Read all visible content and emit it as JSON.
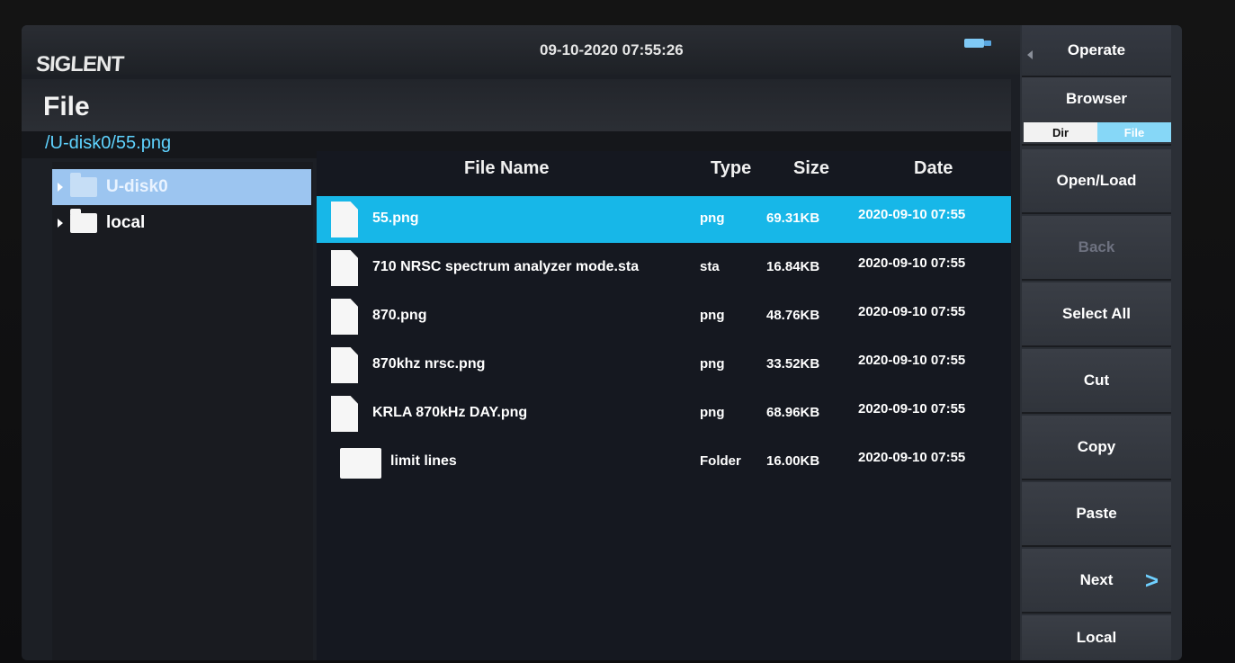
{
  "header": {
    "brand": "SIGLENT",
    "datetime": "09-10-2020 07:55:26",
    "title": "File",
    "path": "/U-disk0/55.png"
  },
  "tree": {
    "items": [
      {
        "label": "U-disk0",
        "selected": true
      },
      {
        "label": "local",
        "selected": false
      }
    ]
  },
  "table": {
    "headers": {
      "name": "File Name",
      "type": "Type",
      "size": "Size",
      "date": "Date"
    },
    "rows": [
      {
        "name": "55.png",
        "type": "png",
        "size": "69.31KB",
        "date": "2020-09-10 07:55",
        "kind": "file",
        "selected": true
      },
      {
        "name": "710 NRSC spectrum analyzer mode.sta",
        "type": "sta",
        "size": "16.84KB",
        "date": "2020-09-10 07:55",
        "kind": "file",
        "selected": false
      },
      {
        "name": "870.png",
        "type": "png",
        "size": "48.76KB",
        "date": "2020-09-10 07:55",
        "kind": "file",
        "selected": false
      },
      {
        "name": "870khz nrsc.png",
        "type": "png",
        "size": "33.52KB",
        "date": "2020-09-10 07:55",
        "kind": "file",
        "selected": false
      },
      {
        "name": "KRLA 870kHz DAY.png",
        "type": "png",
        "size": "68.96KB",
        "date": "2020-09-10 07:55",
        "kind": "file",
        "selected": false
      },
      {
        "name": "limit lines",
        "type": "Folder",
        "size": "16.00KB",
        "date": "2020-09-10 07:55",
        "kind": "folder",
        "selected": false
      }
    ]
  },
  "menu": {
    "operate": "Operate",
    "browser": "Browser",
    "toggle_dir": "Dir",
    "toggle_file": "File",
    "open_load": "Open/Load",
    "back": "Back",
    "select_all": "Select All",
    "cut": "Cut",
    "copy": "Copy",
    "paste": "Paste",
    "next": "Next",
    "local": "Local"
  },
  "colors": {
    "accent": "#17b7e8",
    "path": "#5fd3ff",
    "tree_selected": "#9cc5f0"
  }
}
